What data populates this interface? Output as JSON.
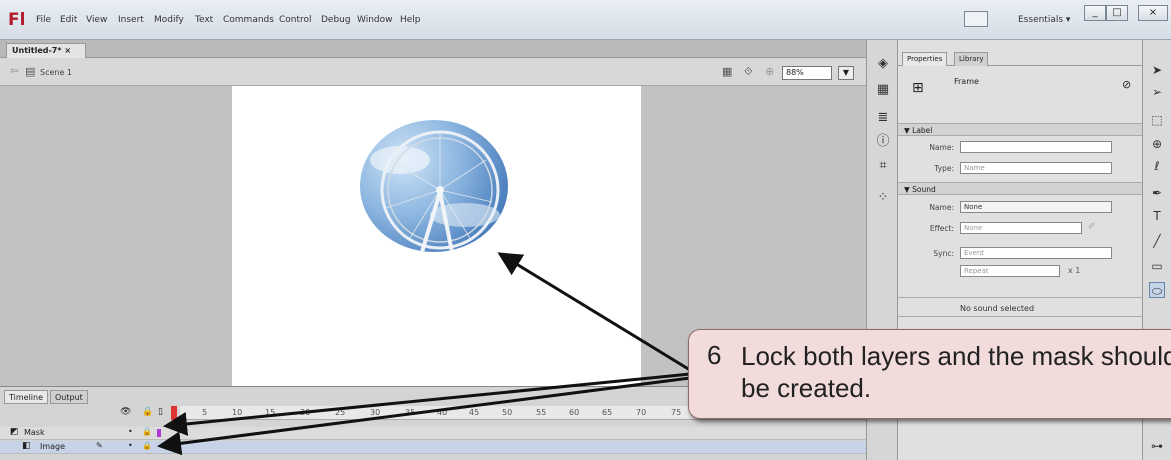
{
  "app": {
    "logo": "Fl"
  },
  "menu": [
    "File",
    "Edit",
    "View",
    "Insert",
    "Modify",
    "Text",
    "Commands",
    "Control",
    "Debug",
    "Window",
    "Help"
  ],
  "workspace": {
    "label": "Essentials ▾"
  },
  "window_buttons": {
    "minimize": "_",
    "maximize": "□",
    "close": "×"
  },
  "document": {
    "tab": "Untitled-7*  ×",
    "scene": "Scene 1",
    "zoom": "88%"
  },
  "timeline": {
    "tabs": [
      "Timeline",
      "Output"
    ],
    "frame_numbers": [
      "5",
      "10",
      "15",
      "20",
      "25",
      "30",
      "35",
      "40",
      "45",
      "50",
      "55",
      "60",
      "65",
      "70",
      "75"
    ],
    "layers": [
      {
        "name": "Mask"
      },
      {
        "name": "Image"
      }
    ]
  },
  "properties": {
    "tabs": [
      "Properties",
      "Library"
    ],
    "type": "Frame",
    "label_section": "▼ Label",
    "name_label": "Name:",
    "type_label": "Type:",
    "type_value": "Name",
    "sound_section": "▼ Sound",
    "sound_name_label": "Name:",
    "sound_name_value": "None",
    "effect_label": "Effect:",
    "effect_value": "None",
    "sync_label": "Sync:",
    "sync_value": "Event",
    "repeat_value": "Repeat",
    "repeat_count": "x 1",
    "no_sound": "No sound selected"
  },
  "callout": {
    "number": "6",
    "text": "Lock both layers and the mask should be created."
  },
  "colors": {
    "callout_bg": "#f2dbdb",
    "logo_red": "#b31c2a",
    "stage": "#ffffff"
  }
}
